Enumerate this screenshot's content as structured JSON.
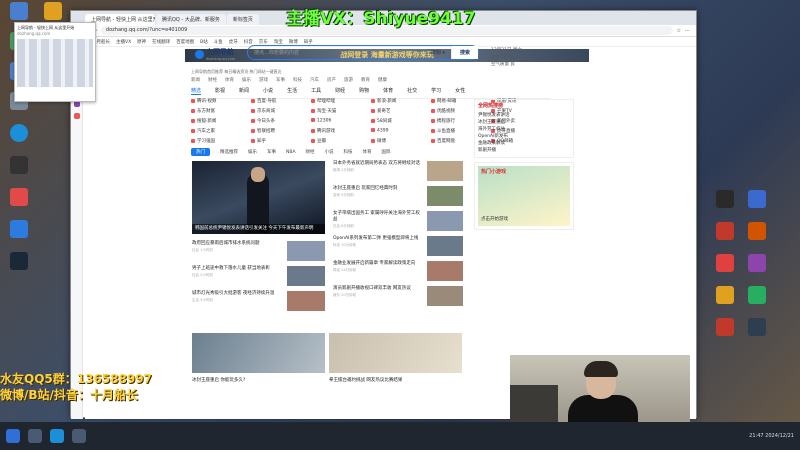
{
  "overlay": {
    "top_text": "主播VX：Shiyue9417",
    "left_line1": "水友QQ5群：136588997",
    "left_line2": "微博/B站/抖音：十月船长"
  },
  "browser": {
    "tabs": [
      "上网导航 - 轻快上网 从这里开始",
      "腾讯QQ - 大品牌、新服务",
      "新标签页"
    ],
    "url": "dozhang.qq.com/?unc=e401009",
    "bookmarks": [
      "收藏",
      "十月船长",
      "主播VX",
      "原神",
      "在线翻译",
      "百度地图",
      "B站",
      "斗鱼",
      "虎牙",
      "抖音",
      "京东",
      "淘宝",
      "微博",
      "知乎"
    ]
  },
  "thumbnail": {
    "title": "上网导航 - 轻快上网 从这里开始",
    "url": "dozhang.qq.com"
  },
  "page": {
    "banner": "战网登录 海量新游戏等你来玩",
    "logo_name": "上网导航",
    "logo_sub": "dozhang.qq.com",
    "search_placeholder": "搜点…你想要的内容",
    "search_engine": "搜狗 ▾",
    "search_button": "搜索",
    "weather": [
      "12月21日 周六",
      "北京 晴 -3~7°C",
      "空气质量 良"
    ],
    "notice": "上网导航首页推荐 每日精选资讯 热门网站一键直达",
    "navrow": [
      "新闻",
      "财经",
      "体育",
      "娱乐",
      "游戏",
      "军事",
      "科技",
      "汽车",
      "房产",
      "旅游",
      "教育",
      "健康"
    ],
    "categories": [
      "精选",
      "影视",
      "新闻",
      "小说",
      "生活",
      "工具",
      "财经",
      "购物",
      "体育",
      "社交",
      "学习",
      "女性"
    ],
    "links": [
      "腾讯·视频",
      "百度·导航",
      "哔哩哔哩",
      "新浪·新闻",
      "网易·邮箱",
      "凤凰·资讯",
      "东方财富",
      "京东商城",
      "淘宝·天猫",
      "爱奇艺",
      "优酷视频",
      "芒果TV",
      "搜狐·新闻",
      "今日头条",
      "12306",
      "58同城",
      "携程旅行",
      "美团外卖",
      "汽车之家",
      "智联招聘",
      "腾讯游戏",
      "4399",
      "斗鱼直播",
      "虎牙直播",
      "学习强国",
      "知乎",
      "豆瓣",
      "微博",
      "百度网盘",
      "QQ邮箱"
    ],
    "news_tabs": [
      "热门",
      "精选推荐",
      "娱乐",
      "军事",
      "NBA",
      "财经",
      "小说",
      "科技",
      "体育",
      "国际"
    ],
    "hero_caption": "韩国前总统尹锡悦发表讲话引发关注 今天下午发布最新声明",
    "news": [
      {
        "title": "日本外务省就近期局势表态 双方将继续对话",
        "meta": "新闻 2分钟前"
      },
      {
        "title": "冰封王座重启 玩家回忆经典时刻",
        "meta": "游戏 5分钟前"
      },
      {
        "title": "女子带病出国务工 家属呼吁关注海外劳工权益",
        "meta": "社会 8分钟前"
      },
      {
        "title": "OpenAI系列发布第二弹 更强模型即将上线",
        "meta": "科技 10分钟前"
      },
      {
        "title": "金融业发展开启新篇章 专家解读政策走向",
        "meta": "财经 15分钟前"
      },
      {
        "title": "演员新剧开播收视口碑双丰收 网友热议",
        "meta": "娱乐 20分钟前"
      }
    ],
    "left_news": [
      {
        "title": "政府回应暴雨后城市排水系统问题",
        "meta": "社会 1小时前"
      },
      {
        "title": "男子上班途中救下落水儿童 获当地表彰",
        "meta": "社会 2小时前"
      },
      {
        "title": "城市灯光秀吸引大批游客 夜经济持续升温",
        "meta": "生活 3小时前"
      }
    ],
    "bottom_captions": [
      "冰封王座重启 你能玩多久?",
      "拳王擂台邀约挑战 网友热议比赛结果"
    ],
    "hot_title": "全网热搜榜",
    "hot_items": [
      "尹锡悦发表讲话",
      "冰封王座重启",
      "海外劳工权益",
      "OpenAI新发布",
      "金融政策解读",
      "新剧开播"
    ],
    "ad_title": "热门小游戏",
    "ad_text": "点击开始游戏"
  },
  "taskbar": {
    "time": "21:47 2024/12/21"
  }
}
